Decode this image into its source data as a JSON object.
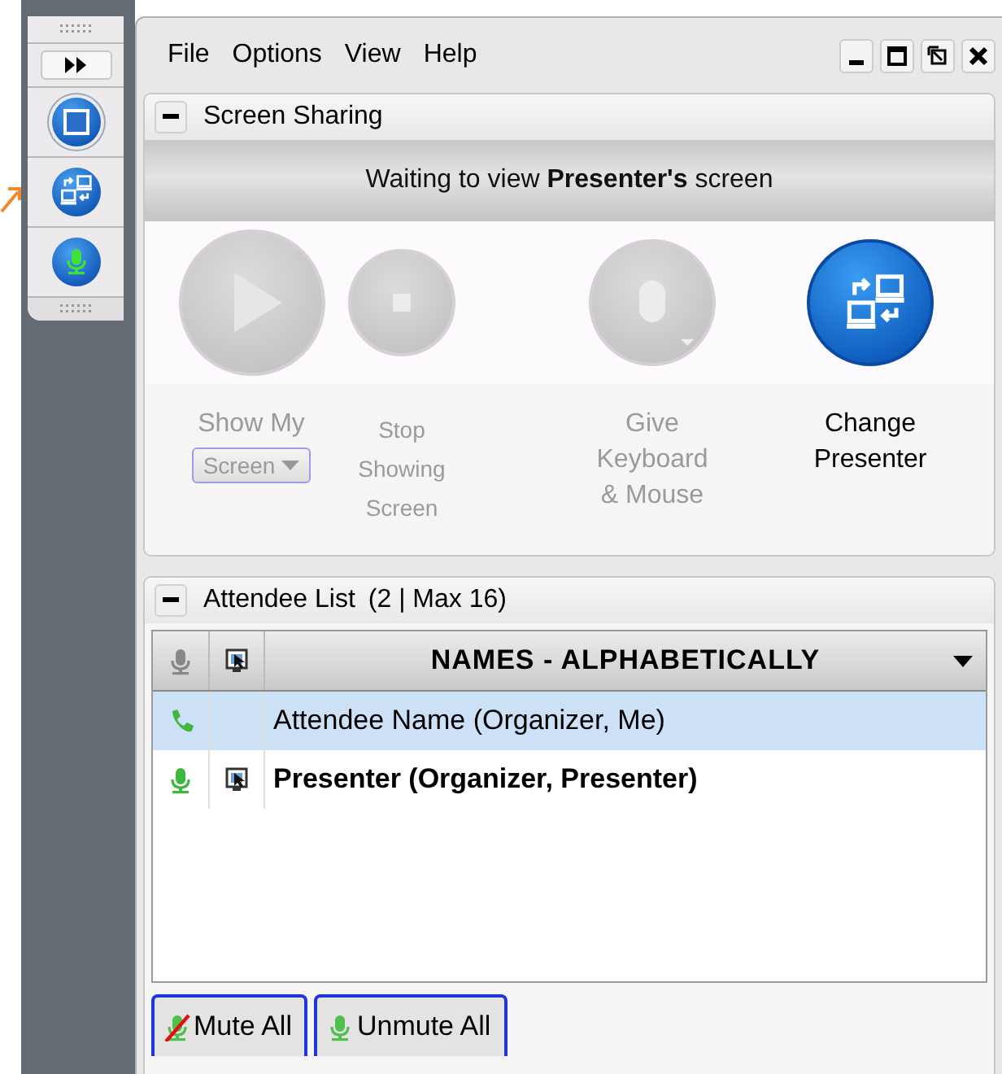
{
  "toolbar": {
    "items": [
      {
        "kind": "window",
        "selected": true
      },
      {
        "kind": "switch",
        "selected": false
      },
      {
        "kind": "mic",
        "selected": false
      }
    ]
  },
  "menu": [
    "File",
    "Options",
    "View",
    "Help"
  ],
  "screen_sharing": {
    "title": "Screen Sharing",
    "banner": "Waiting to view **Presenter's** screen",
    "actions": [
      {
        "kind": "play",
        "enabled": false,
        "lines": [
          "Show My"
        ],
        "dropdown": "Screen"
      },
      {
        "kind": "stop",
        "enabled": false,
        "lines": [
          "Stop",
          "Showing",
          "Screen"
        ]
      },
      {
        "kind": "mouse",
        "enabled": false,
        "lines": [
          "Give",
          "Keyboard",
          "& Mouse"
        ]
      },
      {
        "kind": "switch",
        "enabled": true,
        "lines": [
          "Change",
          "Presenter"
        ]
      }
    ]
  },
  "attendees": {
    "title": "Attendee List",
    "count": "(2 | Max 16)",
    "sort_column": "NAMES - ALPHABETICALLY",
    "rows": [
      {
        "name": "Attendee Name (Organizer, Me)",
        "selected": true,
        "kind": "phone",
        "presenter": false
      },
      {
        "name": "Presenter (Organizer, Presenter)",
        "selected": false,
        "kind": "mic",
        "presenter": true
      }
    ],
    "buttons": [
      {
        "kind": "mute",
        "label": "Mute All"
      },
      {
        "kind": "unmute",
        "label": "Unmute All"
      }
    ]
  }
}
